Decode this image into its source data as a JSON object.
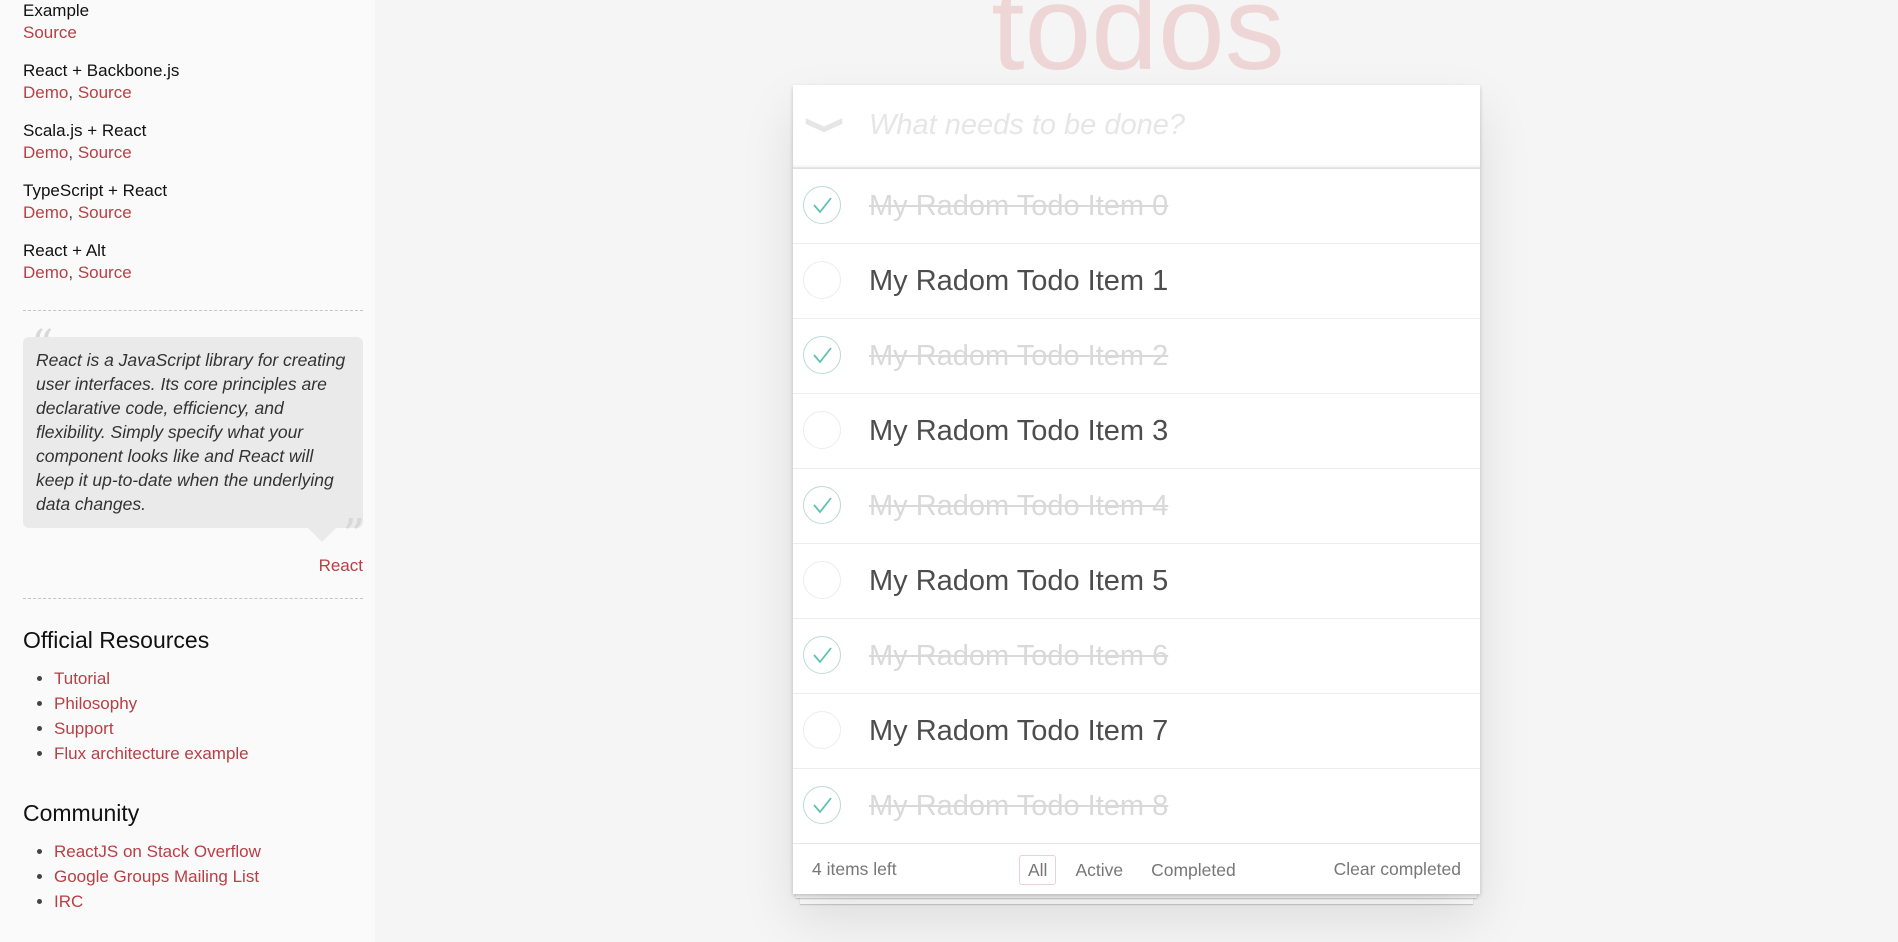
{
  "sidebar": {
    "examples": [
      {
        "title": "Example",
        "links": [
          "Source"
        ]
      },
      {
        "title": "React + Backbone.js",
        "links": [
          "Demo",
          "Source"
        ]
      },
      {
        "title": "Scala.js + React",
        "links": [
          "Demo",
          "Source"
        ]
      },
      {
        "title": "TypeScript + React",
        "links": [
          "Demo",
          "Source"
        ]
      },
      {
        "title": "React + Alt",
        "links": [
          "Demo",
          "Source"
        ]
      }
    ],
    "quote": "React is a JavaScript library for creating user interfaces. Its core principles are declarative code, efficiency, and flexibility. Simply specify what your component looks like and React will keep it up-to-date when the underlying data changes.",
    "quote_cite": "React",
    "official_heading": "Official Resources",
    "official_links": [
      "Tutorial",
      "Philosophy",
      "Support",
      "Flux architecture example"
    ],
    "community_heading": "Community",
    "community_links": [
      "ReactJS on Stack Overflow",
      "Google Groups Mailing List",
      "IRC"
    ]
  },
  "app": {
    "title": "todos",
    "new_todo_placeholder": "What needs to be done?",
    "toggle_all_icon": "chevron-down-icon",
    "check_icon": "checkmark-icon",
    "items": [
      {
        "label": "My Radom Todo Item 0",
        "completed": true
      },
      {
        "label": "My Radom Todo Item 1",
        "completed": false
      },
      {
        "label": "My Radom Todo Item 2",
        "completed": true
      },
      {
        "label": "My Radom Todo Item 3",
        "completed": false
      },
      {
        "label": "My Radom Todo Item 4",
        "completed": true
      },
      {
        "label": "My Radom Todo Item 5",
        "completed": false
      },
      {
        "label": "My Radom Todo Item 6",
        "completed": true
      },
      {
        "label": "My Radom Todo Item 7",
        "completed": false
      },
      {
        "label": "My Radom Todo Item 8",
        "completed": true
      }
    ],
    "footer": {
      "count_text": "4 items left",
      "filters": [
        "All",
        "Active",
        "Completed"
      ],
      "selected_filter": "All",
      "clear_label": "Clear completed"
    },
    "colors": {
      "accent": "#b83f45",
      "check": "#5dc2af",
      "title": "#efd6d6"
    }
  }
}
